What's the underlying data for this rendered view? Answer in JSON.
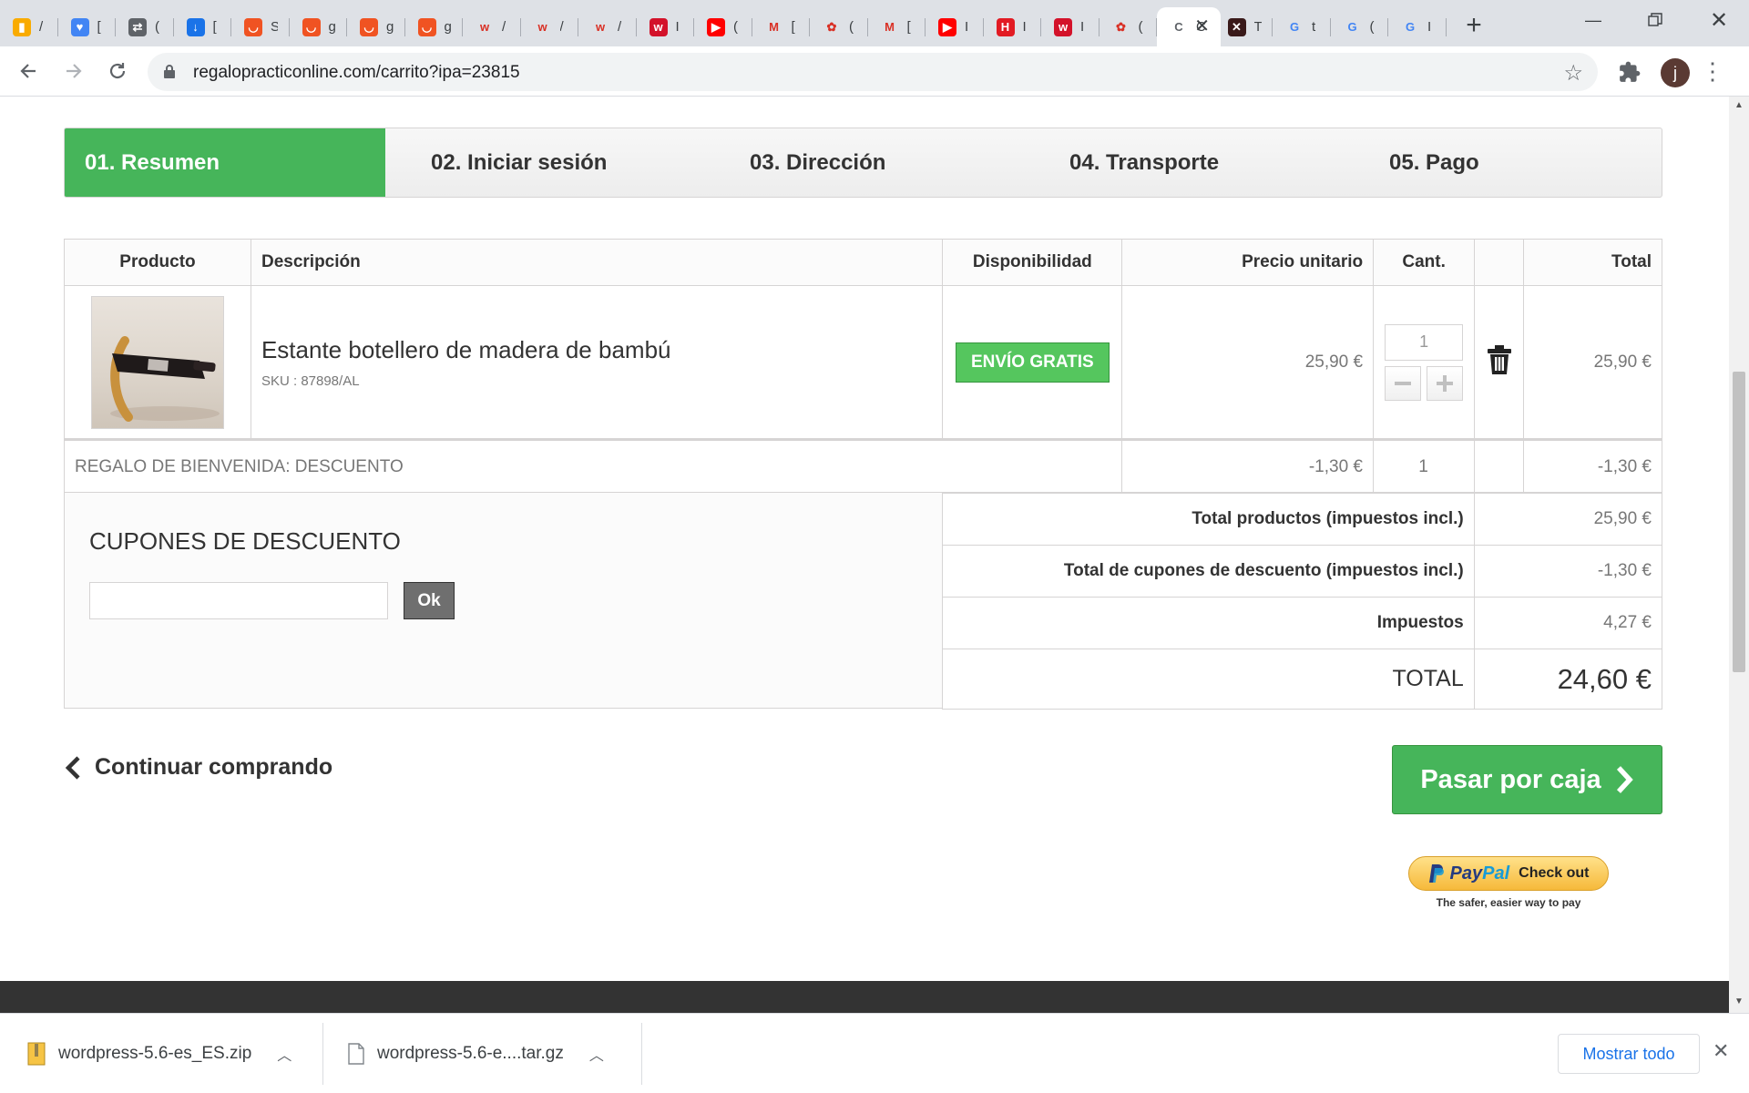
{
  "browser": {
    "tabs": [
      {
        "icon": "analytics-icon",
        "color": "#f9ab00",
        "glyph": "▮"
      },
      {
        "icon": "bookmark-heart-icon",
        "color": "#4285f4",
        "glyph": "♥"
      },
      {
        "icon": "translate-icon",
        "color": "#5f6368",
        "glyph": "⇄"
      },
      {
        "icon": "download-icon",
        "color": "#1a73e8",
        "glyph": "↓"
      },
      {
        "icon": "shop-icon",
        "color": "#f05322",
        "glyph": "◡"
      },
      {
        "icon": "shop-icon",
        "color": "#f05322",
        "glyph": "◡"
      },
      {
        "icon": "shop-icon",
        "color": "#f05322",
        "glyph": "◡"
      },
      {
        "icon": "shop-icon",
        "color": "#f05322",
        "glyph": "◡"
      },
      {
        "icon": "wallapop-icon",
        "color": "#ffffff",
        "glyph": "w"
      },
      {
        "icon": "wallapop-icon",
        "color": "#ffffff",
        "glyph": "w"
      },
      {
        "icon": "wallapop-icon",
        "color": "#ffffff",
        "glyph": "w"
      },
      {
        "icon": "wallapop-round-icon",
        "color": "#d3122a",
        "glyph": "w"
      },
      {
        "icon": "youtube-icon",
        "color": "#ff0000",
        "glyph": "▶"
      },
      {
        "icon": "gmail-icon",
        "color": "#ffffff",
        "glyph": "M"
      },
      {
        "icon": "site-logo-icon",
        "color": "#ffffff",
        "glyph": "✿"
      },
      {
        "icon": "gmail-icon",
        "color": "#ffffff",
        "glyph": "M"
      },
      {
        "icon": "youtube-icon",
        "color": "#ff0000",
        "glyph": "▶"
      },
      {
        "icon": "h-logo-icon",
        "color": "#e21b23",
        "glyph": "H"
      },
      {
        "icon": "wallapop-round-icon",
        "color": "#d3122a",
        "glyph": "w"
      },
      {
        "icon": "site-logo-icon",
        "color": "#ffffff",
        "glyph": "✿"
      },
      {
        "icon": "active-tab-icon",
        "color": "#ffffff",
        "glyph": "C"
      },
      {
        "icon": "x-logo-icon",
        "color": "#3a1a1a",
        "glyph": "✕"
      },
      {
        "icon": "google-icon",
        "color": "#ffffff",
        "glyph": "G"
      },
      {
        "icon": "google-icon",
        "color": "#ffffff",
        "glyph": "G"
      },
      {
        "icon": "google-icon",
        "color": "#ffffff",
        "glyph": "G"
      }
    ],
    "tab_titles": [
      "/",
      "[",
      "(",
      "[",
      "S",
      "g",
      "g",
      "g",
      "/",
      "/",
      "/",
      "I",
      "(",
      "[",
      "(",
      "[",
      "I",
      "I",
      "I",
      "(",
      "C",
      "T",
      "t",
      "(",
      "I"
    ],
    "url": "regalopracticonline.com/carrito?ipa=23815",
    "profile_initial": "j"
  },
  "checkout_steps": [
    {
      "label": "01. Resumen",
      "active": true
    },
    {
      "label": "02. Iniciar sesión",
      "active": false
    },
    {
      "label": "03. Dirección",
      "active": false
    },
    {
      "label": "04. Transporte",
      "active": false
    },
    {
      "label": "05. Pago",
      "active": false
    }
  ],
  "cart": {
    "headers": {
      "product": "Producto",
      "description": "Descripción",
      "availability": "Disponibilidad",
      "unit_price": "Precio unitario",
      "qty": "Cant.",
      "total": "Total"
    },
    "item": {
      "name": "Estante botellero de madera de bambú",
      "sku": "SKU : 87898/AL",
      "availability": "ENVÍO GRATIS",
      "unit_price": "25,90 €",
      "qty": "1",
      "total": "25,90 €"
    },
    "discount": {
      "label": "REGALO DE BIENVENIDA: DESCUENTO",
      "unit_price": "-1,30 €",
      "qty": "1",
      "total": "-1,30 €"
    }
  },
  "coupons": {
    "title": "CUPONES DE DESCUENTO",
    "input_value": "",
    "ok_label": "Ok"
  },
  "totals": {
    "products_label": "Total productos (impuestos incl.)",
    "products_value": "25,90 €",
    "coupons_label": "Total de cupones de descuento (impuestos incl.)",
    "coupons_value": "-1,30 €",
    "tax_label": "Impuestos",
    "tax_value": "4,27 €",
    "total_label": "TOTAL",
    "total_value": "24,60 €"
  },
  "actions": {
    "continue_label": "Continuar comprando",
    "checkout_label": "Pasar por caja",
    "paypal_pay": "Pay",
    "paypal_pal": "Pal",
    "paypal_checkout": "Check out",
    "paypal_tagline": "The safer, easier way to pay"
  },
  "downloads": {
    "items": [
      {
        "name": "wordpress-5.6-es_ES.zip",
        "icon": "zip-file-icon"
      },
      {
        "name": "wordpress-5.6-e....tar.gz",
        "icon": "file-icon"
      }
    ],
    "show_all": "Mostrar todo"
  },
  "colors": {
    "accent_green": "#46b55a",
    "badge_green": "#55c65e",
    "chrome_tabbar": "#dee1e6"
  }
}
